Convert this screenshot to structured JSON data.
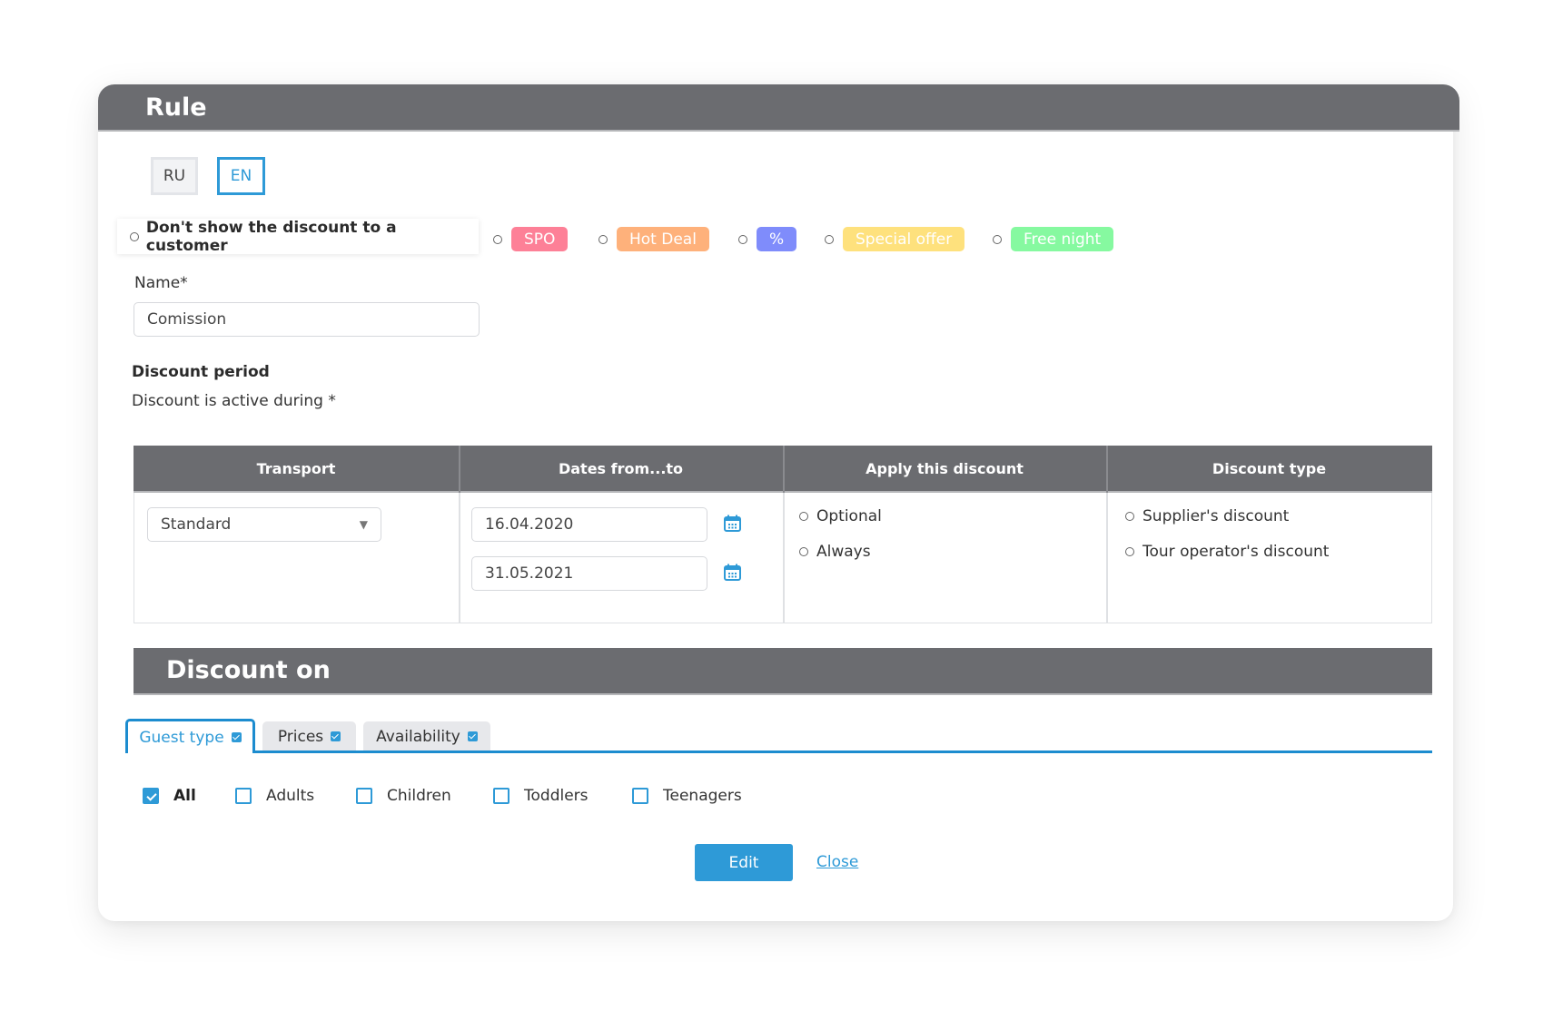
{
  "dialog": {
    "title": "Rule",
    "languages": [
      {
        "label": "RU",
        "selected": false
      },
      {
        "label": "EN",
        "selected": true
      }
    ]
  },
  "display_options": {
    "hide_label": "Don't show the discount to a customer",
    "tags": [
      {
        "label": "SPO",
        "color": "#fd8097"
      },
      {
        "label": "Hot Deal",
        "color": "#feb17b"
      },
      {
        "label": "%",
        "color": "#7f8cfb"
      },
      {
        "label": "Special offer",
        "color": "#fee17d"
      },
      {
        "label": "Free night",
        "color": "#86f9a0"
      }
    ]
  },
  "name_field": {
    "label": "Name*",
    "value": "Comission"
  },
  "discount_period": {
    "heading": "Discount period",
    "subheading": "Discount is active during *"
  },
  "period_table": {
    "headers": [
      "Transport",
      "Dates from...to",
      "Apply this discount",
      "Discount type"
    ],
    "transport": {
      "selected": "Standard"
    },
    "dates": {
      "from": "16.04.2020",
      "to": "31.05.2021"
    },
    "apply_options": [
      "Optional",
      "Always"
    ],
    "type_options": [
      "Supplier's discount",
      "Tour operator's discount"
    ]
  },
  "discount_on": {
    "heading": "Discount on",
    "tabs": [
      {
        "label": "Guest type",
        "active": true,
        "checked": true
      },
      {
        "label": "Prices",
        "active": false,
        "checked": true
      },
      {
        "label": "Availability",
        "active": false,
        "checked": true
      }
    ],
    "guest_types": [
      {
        "label": "All",
        "checked": true
      },
      {
        "label": "Adults",
        "checked": false
      },
      {
        "label": "Children",
        "checked": false
      },
      {
        "label": "Toddlers",
        "checked": false
      },
      {
        "label": "Teenagers",
        "checked": false
      }
    ]
  },
  "actions": {
    "edit_label": "Edit",
    "close_label": "Close"
  },
  "colors": {
    "accent": "#2e9ad7",
    "header_bg": "#6b6c70"
  }
}
